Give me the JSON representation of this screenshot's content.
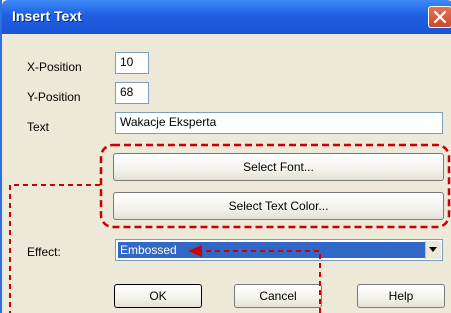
{
  "window": {
    "title": "Insert Text"
  },
  "fields": {
    "x_position": {
      "label": "X-Position",
      "value": "10"
    },
    "y_position": {
      "label": "Y-Position",
      "value": "68"
    },
    "text": {
      "label": "Text",
      "value": "Wakacje Eksperta"
    }
  },
  "buttons": {
    "select_font": "Select Font...",
    "select_text_color": "Select Text Color...",
    "ok": "OK",
    "cancel": "Cancel",
    "help": "Help"
  },
  "effect": {
    "label": "Effect:",
    "selected": "Embossed"
  },
  "icons": {
    "close": "close-icon",
    "dropdown": "chevron-down-icon"
  },
  "colors": {
    "titlebar": "#1f5fe0",
    "dialog_bg": "#ece9d8",
    "selection": "#3168c6",
    "annotation": "#cc0000",
    "close_button": "#c84a2c"
  }
}
